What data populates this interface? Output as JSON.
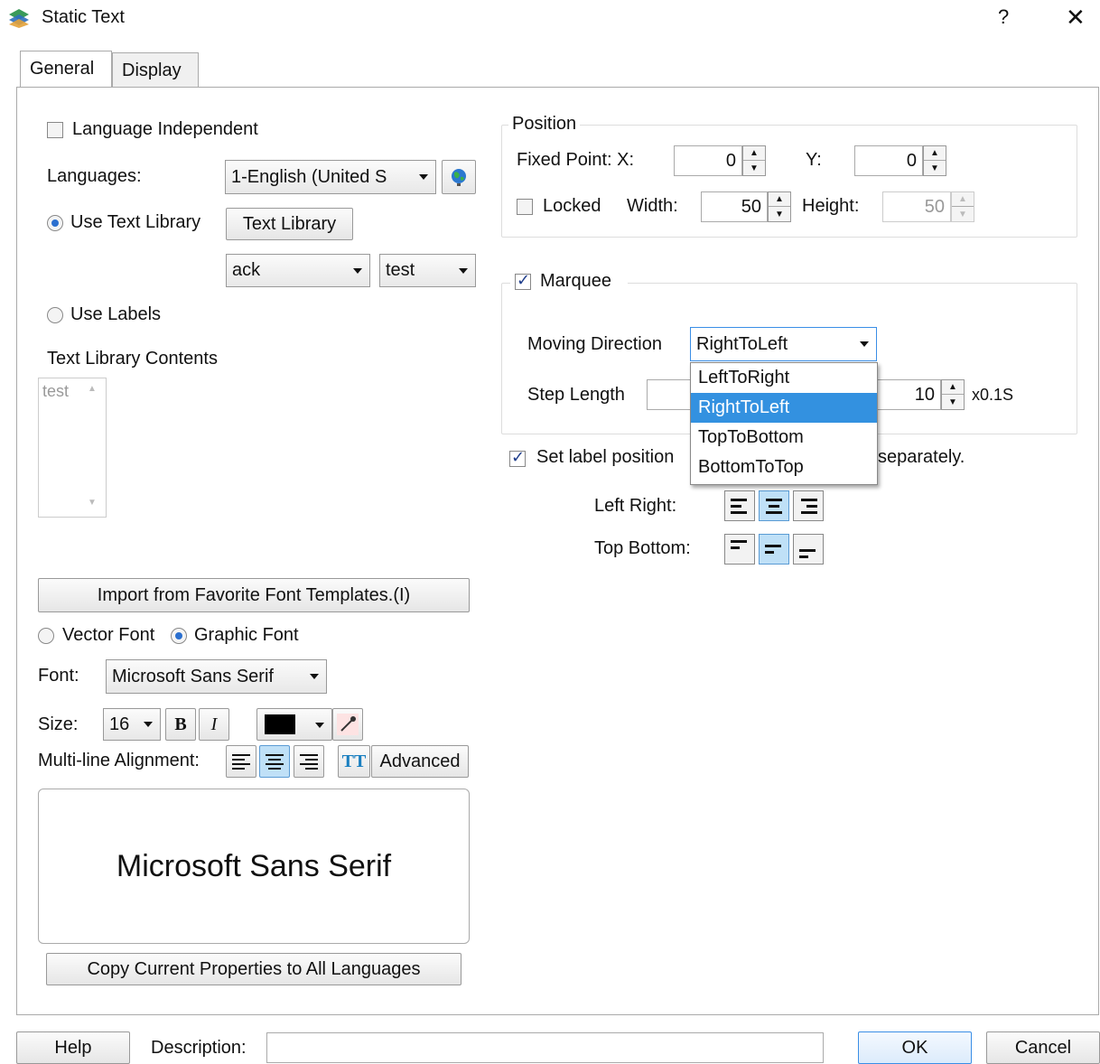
{
  "window": {
    "title": "Static Text",
    "help_glyph": "?",
    "close_glyph": "✕"
  },
  "tabs": [
    {
      "label": "General"
    },
    {
      "label": "Display"
    }
  ],
  "language": {
    "independent_label": "Language Independent",
    "independent_checked": false,
    "languages_label": "Languages:",
    "languages_value": "1-English (United S",
    "use_text_library_label": "Use Text Library",
    "text_library_button": "Text Library",
    "library_combo1": "ack",
    "library_combo2": "test",
    "use_labels_label": "Use Labels",
    "contents_label": "Text Library Contents",
    "contents_items": [
      "test"
    ]
  },
  "font": {
    "import_button": "Import from Favorite Font Templates.(I)",
    "vector_font_label": "Vector Font",
    "graphic_font_label": "Graphic Font",
    "font_label": "Font:",
    "font_value": "Microsoft Sans Serif",
    "size_label": "Size:",
    "size_value": "16",
    "bold_glyph": "B",
    "italic_glyph": "I",
    "color": "#000000",
    "multiline_label": "Multi-line Alignment:",
    "tt_glyph": "TT",
    "advanced_button": "Advanced",
    "preview_text": "Microsoft Sans Serif",
    "copy_button": "Copy Current Properties to All Languages"
  },
  "position": {
    "title": "Position",
    "fixed_point_label": "Fixed Point: X:",
    "x_value": "0",
    "y_label": "Y:",
    "y_value": "0",
    "locked_label": "Locked",
    "width_label": "Width:",
    "width_value": "50",
    "height_label": "Height:",
    "height_value": "50"
  },
  "marquee": {
    "label": "Marquee",
    "checked": true,
    "moving_direction_label": "Moving Direction",
    "moving_direction_value": "RightToLeft",
    "options": [
      "LeftToRight",
      "RightToLeft",
      "TopToBottom",
      "BottomToTop"
    ],
    "selected_option": "RightToLeft",
    "step_length_label": "Step Length",
    "interval_value": "10",
    "interval_unit": "x0.1S"
  },
  "label_position": {
    "label_start": "Set label position",
    "label_end": "separately.",
    "checked": true,
    "left_right_label": "Left Right:",
    "top_bottom_label": "Top Bottom:"
  },
  "footer": {
    "help_button": "Help",
    "description_label": "Description:",
    "description_value": "",
    "ok_button": "OK",
    "cancel_button": "Cancel"
  },
  "colors": {
    "accent": "#3391e0",
    "selected_button": "#bfe0f7"
  }
}
